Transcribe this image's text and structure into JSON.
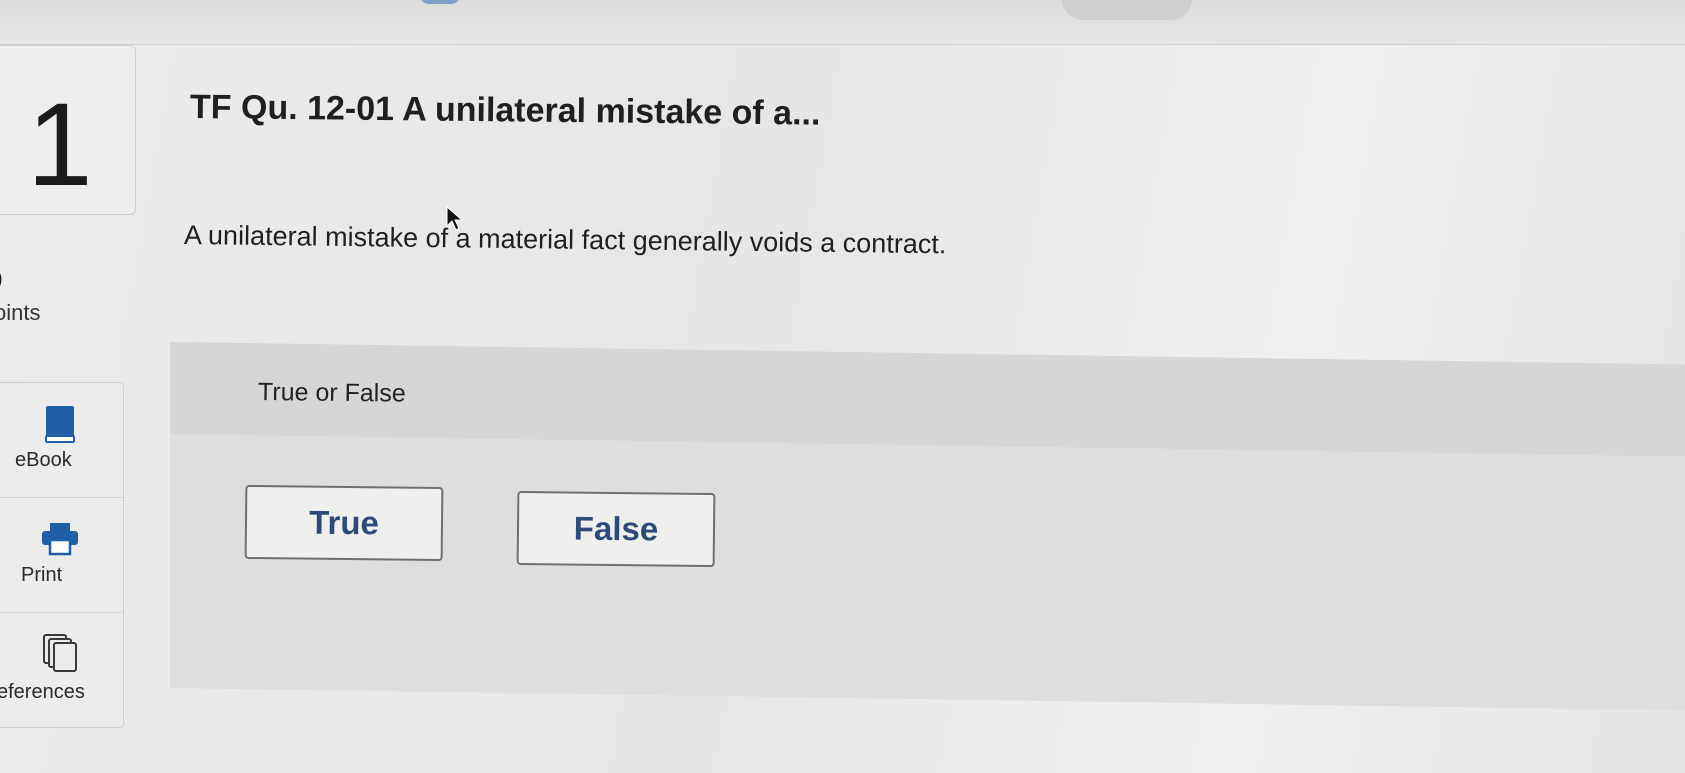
{
  "question": {
    "number": "1",
    "title": "TF Qu. 12-01 A unilateral mistake of a...",
    "text": "A unilateral mistake of a material fact generally voids a contract."
  },
  "points": {
    "value": ")",
    "label": "oints"
  },
  "sidebar": {
    "items": [
      {
        "label": "eBook",
        "icon": "book-icon"
      },
      {
        "label": "Print",
        "icon": "printer-icon"
      },
      {
        "label": "eferences",
        "icon": "references-icon"
      }
    ]
  },
  "answer": {
    "prompt": "True or False",
    "options": [
      {
        "label": "True"
      },
      {
        "label": "False"
      }
    ]
  },
  "colors": {
    "book_icon": "#1f5fa8",
    "printer_icon": "#1f5fa8",
    "option_text": "#2e4a78"
  }
}
